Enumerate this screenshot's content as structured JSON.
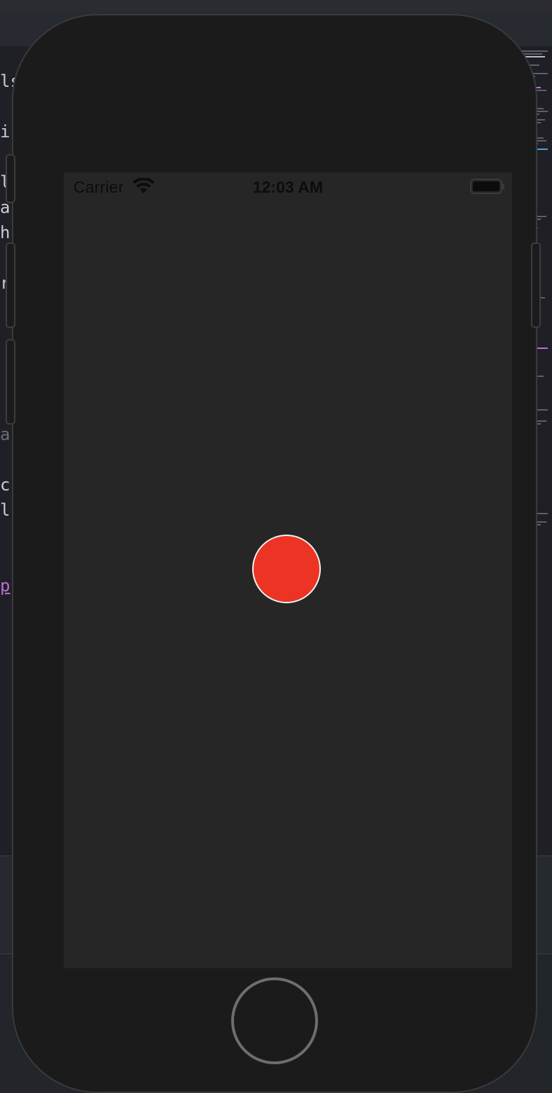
{
  "status_bar": {
    "carrier": "Carrier",
    "time": "12:03 AM",
    "wifi_icon": "wifi-icon",
    "battery_icon": "battery-icon"
  },
  "main": {
    "record_button_color": "#ec3424"
  },
  "background_code_fragments": [
    "ls",
    "i",
    "l",
    "a",
    "h",
    "r",
    "a",
    "c",
    "l",
    "p"
  ],
  "colors": {
    "screen_background": "#262626",
    "device_body": "#1b1b1c",
    "record_red": "#ec3424"
  }
}
